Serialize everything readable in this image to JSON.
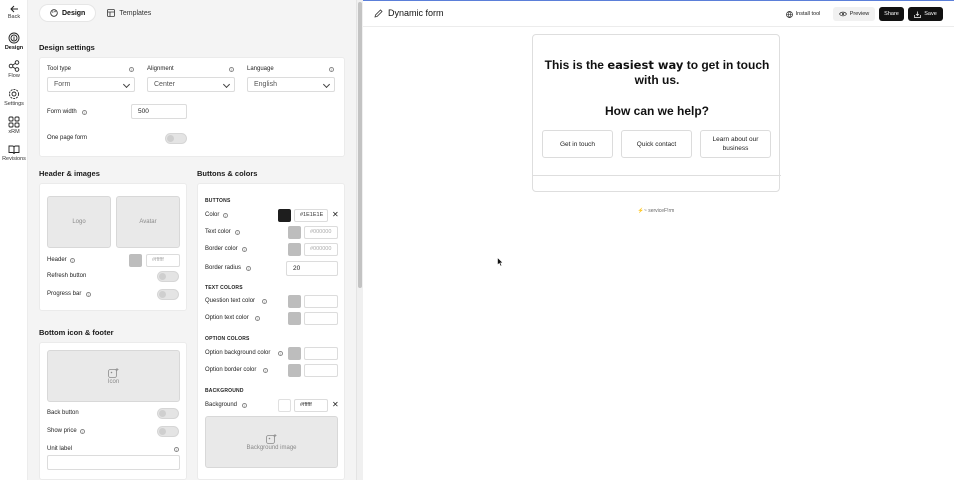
{
  "rail": {
    "back": "Back",
    "items": [
      {
        "label": "Design",
        "icon": "fingerprint-icon",
        "active": true
      },
      {
        "label": "Flow",
        "icon": "share-nodes-icon",
        "active": false
      },
      {
        "label": "Settings",
        "icon": "gear-icon",
        "active": false
      },
      {
        "label": "xRM",
        "icon": "grid-squares-icon",
        "active": false
      },
      {
        "label": "Revisions",
        "icon": "book-open-icon",
        "active": false
      }
    ]
  },
  "tabs": [
    {
      "label": "Design",
      "icon": "palette-icon",
      "active": true
    },
    {
      "label": "Templates",
      "icon": "layout-icon",
      "active": false
    }
  ],
  "design_settings": {
    "title": "Design settings",
    "tool_type_label": "Tool type",
    "tool_type_value": "Form",
    "alignment_label": "Alignment",
    "alignment_value": "Center",
    "language_label": "Language",
    "language_value": "English",
    "form_width_label": "Form width",
    "form_width_value": "500",
    "one_page_label": "One page form"
  },
  "header_images": {
    "title": "Header & images",
    "logo": "Logo",
    "avatar": "Avatar",
    "header_label": "Header",
    "header_hex": "#ffffff",
    "refresh_label": "Refresh button",
    "progress_label": "Progress bar"
  },
  "bottom": {
    "title": "Bottom icon & footer",
    "icon_label": "Icon",
    "back_button": "Back button",
    "show_price": "Show price",
    "unit_label": "Unit label"
  },
  "buttons_colors": {
    "title": "Buttons & colors",
    "buttons_heading": "BUTTONS",
    "color_label": "Color",
    "color_hex": "#1E1E1E",
    "text_color_label": "Text color",
    "text_color_placeholder": "#000000",
    "border_color_label": "Border color",
    "border_color_placeholder": "#000000",
    "border_radius_label": "Border radius",
    "border_radius_value": "20",
    "text_colors_heading": "TEXT COLORS",
    "question_text_label": "Question text color",
    "option_text_label": "Option text color",
    "option_colors_heading": "OPTION COLORS",
    "option_bg_label": "Option background color",
    "option_border_label": "Option border color",
    "background_heading": "BACKGROUND",
    "background_label": "Background",
    "background_hex": "#ffffff",
    "background_image": "Background image"
  },
  "topbar": {
    "title": "Dynamic form",
    "install_tool": "Install tool",
    "preview": "Preview",
    "share": "Share",
    "save": "Save"
  },
  "form_preview": {
    "headline_before": "This is the ",
    "headline_emph": "easiest way",
    "headline_after": " to get in touch with us.",
    "question": "How can we help?",
    "options": [
      "Get in touch",
      "Quick contact",
      "Learn about our business"
    ],
    "branding": "⚡~ serviceF!rm"
  },
  "colors": {
    "accent_dark": "#1E1E1E",
    "panel_bg": "#f4f4f4",
    "top_line": "#5b7fd9"
  }
}
